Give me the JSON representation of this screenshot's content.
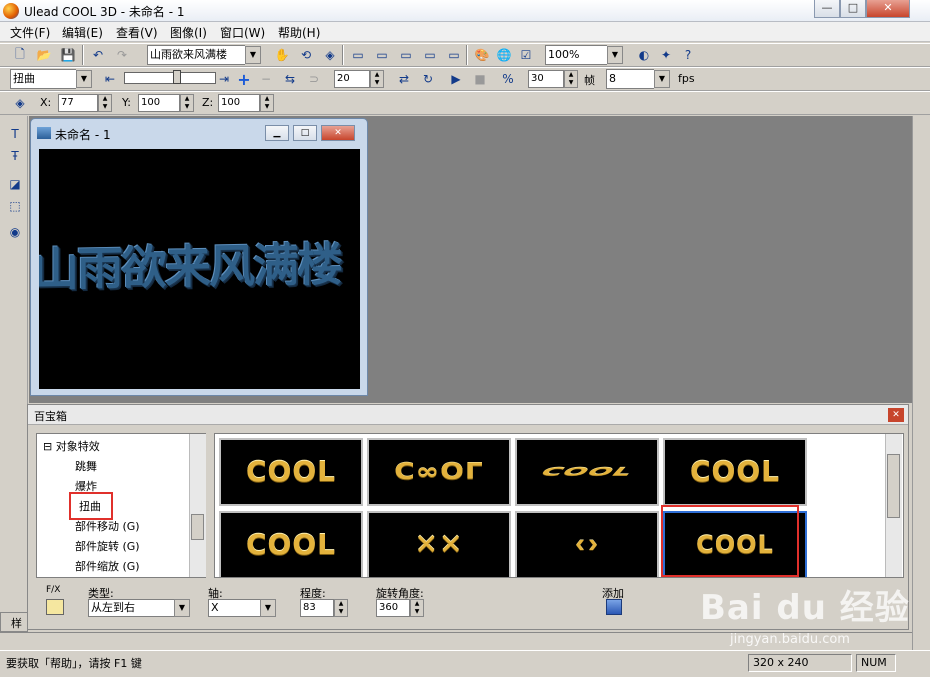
{
  "window": {
    "title": "Ulead COOL 3D - 未命名 - 1",
    "min": "—",
    "max": "□",
    "close": "✕"
  },
  "menu": [
    "文件(F)",
    "编辑(E)",
    "查看(V)",
    "图像(I)",
    "窗口(W)",
    "帮助(H)"
  ],
  "toolbar1": {
    "object_combo": "山雨欲来风满楼",
    "zoom_combo": "100%"
  },
  "toolbar2": {
    "effect_combo": "扭曲",
    "frame_value": "20",
    "speed_value": "30",
    "frames_label": "帧",
    "fps_value": "8",
    "fps_label": "fps"
  },
  "toolbar3": {
    "x_label": "X:",
    "x_value": "77",
    "y_label": "Y:",
    "y_value": "100",
    "z_label": "Z:",
    "z_value": "100"
  },
  "child_window": {
    "title": "未命名 - 1",
    "canvas_text": "山雨欲来风满楼"
  },
  "easy_palette": {
    "title": "百宝箱",
    "close": "✕",
    "tree": {
      "parent": "对象特效",
      "items": [
        "跳舞",
        "爆炸",
        "扭曲",
        "部件移动 (G)",
        "部件旋转 (G)",
        "部件缩放 (G)"
      ],
      "selected": "扭曲"
    },
    "thumbnails": [
      "COOL",
      "C∞OΓ",
      "COOL",
      "COOL",
      "COOL",
      "✕✕",
      "⟨⟩",
      "COOL"
    ],
    "attributes": {
      "fx_label": "F/X",
      "type_label": "类型:",
      "type_value": "从左到右",
      "axis_label": "轴:",
      "axis_value": "X",
      "degree_label": "程度:",
      "degree_value": "83",
      "rotate_label": "旋转角度:",
      "rotate_value": "360",
      "add_label": "添加"
    }
  },
  "side_tab": "样",
  "status": {
    "hint": "要获取「帮助」，请按 F1 键",
    "size": "320 x 240",
    "num": "NUM"
  },
  "watermark": {
    "brand": "Bai du 经验",
    "url": "jingyan.baidu.com"
  },
  "colors": {
    "highlight_box": "#e0302b",
    "canvas_text": "#2f5f88",
    "thumb_gold": "#e3b23c"
  }
}
